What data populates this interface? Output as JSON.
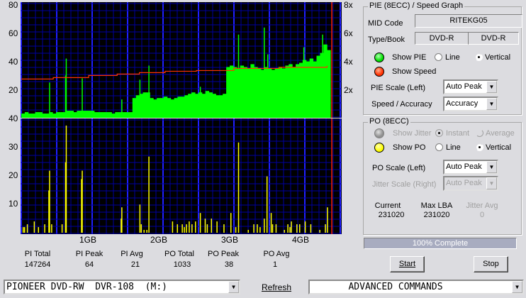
{
  "colors": {
    "pie": "#00ff00",
    "speed": "#ff3300",
    "po": "#ffff00",
    "grid_minor": "#0000a0",
    "grid_major": "#2020ff",
    "plot_bg": "#000000",
    "end_marker": "#ff2000",
    "progress": "#a8acc0"
  },
  "pie_chart": {
    "left_ticks": [
      "80",
      "60",
      "40",
      "20"
    ],
    "right_ticks": [
      "8x",
      "6x",
      "4x",
      "2x"
    ]
  },
  "po_chart": {
    "left_ticks": [
      "40",
      "30",
      "20",
      "10"
    ]
  },
  "x_ticks": [
    "1GB",
    "2GB",
    "3GB",
    "4GB"
  ],
  "chart_data": [
    {
      "type": "bar",
      "name_shown": "",
      "xunit": "GB",
      "xlim": [
        0,
        4.47
      ],
      "ylim": [
        0,
        80
      ],
      "y2lim": [
        0,
        8
      ],
      "pie_step_gb": 0.05,
      "pie_values": [
        3,
        4,
        3,
        3,
        4,
        4,
        3,
        3,
        4,
        3,
        4,
        4,
        4,
        5,
        5,
        4,
        5,
        5,
        5,
        5,
        5,
        4,
        4,
        4,
        4,
        4,
        3,
        4,
        4,
        4,
        4,
        4,
        14,
        16,
        17,
        18,
        18,
        14,
        13,
        14,
        14,
        15,
        14,
        13,
        14,
        15,
        15,
        16,
        17,
        18,
        17,
        18,
        17,
        19,
        18,
        17,
        16,
        16,
        17,
        36,
        37,
        36,
        35,
        37,
        36,
        35,
        38,
        36,
        35,
        34,
        36,
        35,
        34,
        35,
        36,
        35,
        37,
        38,
        36,
        38,
        39,
        41,
        40,
        42,
        40,
        44,
        46,
        52,
        48
      ],
      "pie_spikes": [
        [
          0.4,
          25
        ],
        [
          0.63,
          30
        ],
        [
          0.64,
          42
        ],
        [
          0.87,
          28
        ],
        [
          1.44,
          13
        ],
        [
          1.7,
          27
        ],
        [
          1.83,
          37
        ],
        [
          2.57,
          22
        ],
        [
          3.12,
          59
        ],
        [
          3.49,
          64
        ],
        [
          3.54,
          45
        ],
        [
          4.06,
          50
        ],
        [
          4.33,
          59
        ]
      ],
      "speed": [
        [
          0,
          2.75
        ],
        [
          0.46,
          2.85
        ],
        [
          0.97,
          3.0
        ],
        [
          1.38,
          3.1
        ],
        [
          1.7,
          3.2
        ],
        [
          2.07,
          3.3
        ],
        [
          2.52,
          3.35
        ],
        [
          3.06,
          3.5
        ],
        [
          3.72,
          3.58
        ],
        [
          4.4,
          3.65
        ]
      ],
      "end_gb": 4.47
    },
    {
      "type": "bar",
      "xunit": "GB",
      "xlim": [
        0,
        4.47
      ],
      "ylim": [
        0,
        40
      ],
      "po_values": [
        [
          0.02,
          2
        ],
        [
          0.04,
          2
        ],
        [
          0.08,
          3
        ],
        [
          0.18,
          4
        ],
        [
          0.24,
          2
        ],
        [
          0.33,
          3
        ],
        [
          0.39,
          15
        ],
        [
          0.4,
          22
        ],
        [
          0.43,
          3
        ],
        [
          0.58,
          3
        ],
        [
          0.63,
          25
        ],
        [
          0.64,
          38
        ],
        [
          0.86,
          19
        ],
        [
          0.87,
          22
        ],
        [
          1.43,
          5
        ],
        [
          1.44,
          9
        ],
        [
          1.7,
          10
        ],
        [
          1.72,
          3
        ],
        [
          1.76,
          1
        ],
        [
          1.8,
          1
        ],
        [
          1.83,
          27
        ],
        [
          2.17,
          4
        ],
        [
          2.24,
          3
        ],
        [
          2.31,
          3
        ],
        [
          2.34,
          2
        ],
        [
          2.37,
          3
        ],
        [
          2.41,
          4
        ],
        [
          2.45,
          3
        ],
        [
          2.5,
          4
        ],
        [
          2.57,
          7
        ],
        [
          2.64,
          5
        ],
        [
          2.67,
          3
        ],
        [
          2.73,
          5
        ],
        [
          2.81,
          4
        ],
        [
          2.91,
          3
        ],
        [
          3.01,
          7
        ],
        [
          3.08,
          2
        ],
        [
          3.12,
          32
        ],
        [
          3.26,
          1
        ],
        [
          3.34,
          3
        ],
        [
          3.39,
          3
        ],
        [
          3.43,
          2
        ],
        [
          3.49,
          5
        ],
        [
          3.53,
          20
        ],
        [
          3.59,
          7
        ],
        [
          3.61,
          3
        ],
        [
          3.66,
          3
        ],
        [
          3.78,
          1
        ],
        [
          3.83,
          3
        ],
        [
          3.86,
          2
        ],
        [
          3.88,
          4
        ],
        [
          3.96,
          3
        ],
        [
          4.0,
          3
        ],
        [
          4.08,
          4
        ],
        [
          4.16,
          3
        ],
        [
          4.29,
          1
        ],
        [
          4.37,
          3
        ],
        [
          4.4,
          9
        ]
      ],
      "end_gb": 4.47
    }
  ],
  "stats": {
    "labels": [
      "PI Total",
      "PI Peak",
      "PI Avg",
      "PO Total",
      "PO Peak",
      "PO Avg"
    ],
    "values": [
      "147264",
      "64",
      "21",
      "1033",
      "38",
      "1"
    ]
  },
  "pie_group": {
    "title": "PIE (8ECC) / Speed Graph",
    "mid_label": "MID Code",
    "mid_value": "RITEKG05",
    "type_label": "Type/Book",
    "type_value": "DVD-R",
    "book_value": "DVD-R",
    "show_pie": "Show PIE",
    "line": "Line",
    "vertical": "Vertical",
    "show_speed": "Show Speed",
    "scale_label": "PIE Scale (Left)",
    "scale_value": "Auto Peak",
    "accuracy_label": "Speed / Accuracy",
    "accuracy_value": "Accuracy"
  },
  "po_group": {
    "title": "PO (8ECC)",
    "show_jitter": "Show Jitter",
    "instant": "Instant",
    "average": "Average",
    "show_po": "Show PO",
    "line": "Line",
    "vertical": "Vertical",
    "scale_label": "PO Scale (Left)",
    "scale_value": "Auto Peak",
    "jitter_scale_label": "Jitter Scale (Right)",
    "jitter_scale_value": "Auto Peak",
    "current_label": "Current",
    "current_value": "231020",
    "maxlba_label": "Max LBA",
    "maxlba_value": "231020",
    "jitter_avg_label": "Jitter Avg",
    "jitter_avg_value": "0"
  },
  "progress": {
    "text": "100% Complete",
    "percent": 100
  },
  "buttons": {
    "start": "Start",
    "stop": "Stop",
    "refresh": "Refresh"
  },
  "drive": {
    "value": "PIONEER DVD-RW  DVR-108  (M:)"
  },
  "advanced": {
    "value": "ADVANCED COMMANDS"
  }
}
